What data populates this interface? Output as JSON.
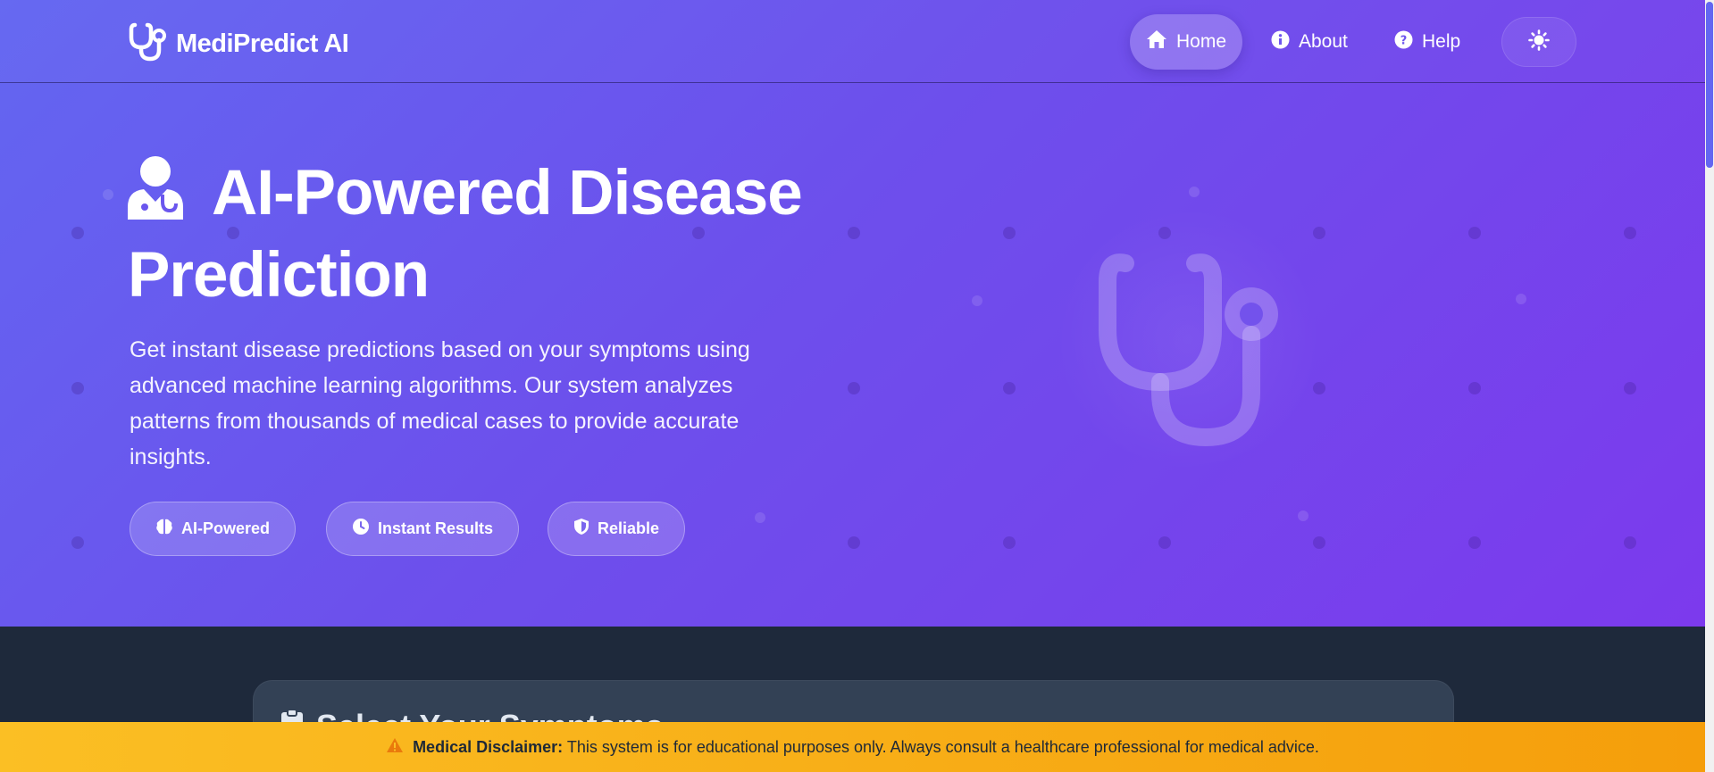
{
  "brand": {
    "name": "MediPredict AI",
    "icon": "stethoscope-icon"
  },
  "nav": {
    "items": [
      {
        "label": "Home",
        "icon": "home-icon",
        "active": true
      },
      {
        "label": "About",
        "icon": "info-icon",
        "active": false
      },
      {
        "label": "Help",
        "icon": "question-icon",
        "active": false
      }
    ],
    "theme_toggle_icon": "sun-icon"
  },
  "hero": {
    "title": "AI-Powered Disease Prediction",
    "title_icon": "doctor-icon",
    "description": "Get instant disease predictions based on your symptoms using advanced machine learning algorithms. Our system analyzes patterns from thousands of medical cases to provide accurate insights.",
    "badges": [
      {
        "label": "AI-Powered",
        "icon": "brain-icon"
      },
      {
        "label": "Instant Results",
        "icon": "clock-icon"
      },
      {
        "label": "Reliable",
        "icon": "shield-icon"
      }
    ],
    "illustration_icon": "stethoscope-icon"
  },
  "symptoms_card": {
    "title": "Select Your Symptoms",
    "icon": "clipboard-icon"
  },
  "disclaimer": {
    "icon": "warning-icon",
    "label": "Medical Disclaimer:",
    "text": "This system is for educational purposes only. Always consult a healthcare professional for medical advice."
  },
  "colors": {
    "hero_gradient_start": "#6366f1",
    "hero_gradient_end": "#7c3aed",
    "page_background": "#1e293b",
    "card_background": "#334155",
    "disclaimer_start": "#fbbf24",
    "disclaimer_end": "#f59e0b"
  }
}
